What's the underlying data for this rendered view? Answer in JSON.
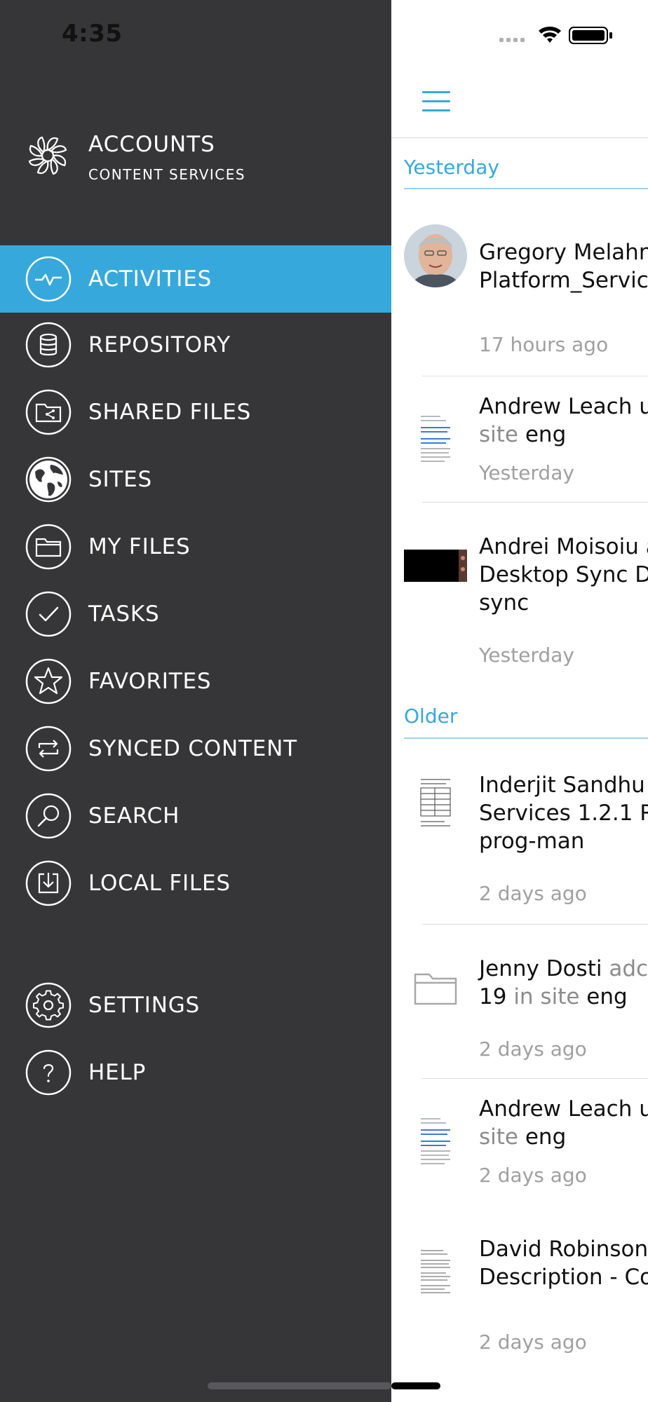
{
  "status_bar": {
    "time": "4:35"
  },
  "account": {
    "title": "ACCOUNTS",
    "subtitle": "CONTENT SERVICES"
  },
  "menu": {
    "activities": "ACTIVITIES",
    "repository": "REPOSITORY",
    "shared_files": "SHARED FILES",
    "sites": "SITES",
    "my_files": "MY FILES",
    "tasks": "TASKS",
    "favorites": "FAVORITES",
    "synced_content": "SYNCED CONTENT",
    "search": "SEARCH",
    "local_files": "LOCAL FILES",
    "settings": "SETTINGS",
    "help": "HELP"
  },
  "colors": {
    "accent": "#37a8db",
    "drawer_bg": "#363638"
  },
  "sections": {
    "yesterday": "Yesterday",
    "older": "Older"
  },
  "activities": [
    {
      "line1": "Gregory Melahn",
      "line2": "Platform_Servic",
      "time": "17 hours ago"
    },
    {
      "line1": "Andrew Leach u",
      "line2a": "site ",
      "line2b": "eng",
      "time": "Yesterday"
    },
    {
      "line1": "Andrei Moisoiu a",
      "line2": "Desktop Sync D",
      "line3": "sync",
      "time": "Yesterday"
    },
    {
      "line1": "Inderjit Sandhu",
      "line2": "Services 1.2.1 Rt",
      "line3": "prog-man",
      "time": "2 days ago"
    },
    {
      "line1a": "Jenny Dosti ",
      "line1b": "adc",
      "line2a": "19 ",
      "line2b": "in site ",
      "line2c": "eng",
      "time": "2 days ago"
    },
    {
      "line1": "Andrew Leach u",
      "line2a": "site ",
      "line2b": "eng",
      "time": "2 days ago"
    },
    {
      "line1": "David Robinson",
      "line2": "Description - Co",
      "time": "2 days ago"
    }
  ]
}
